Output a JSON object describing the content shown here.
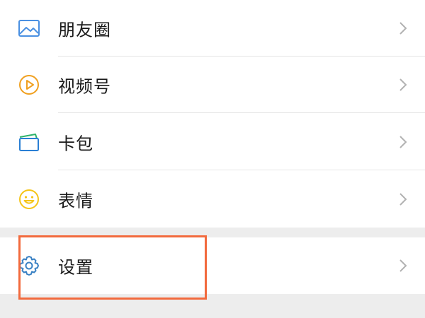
{
  "menu": {
    "items": [
      {
        "label": "朋友圈",
        "icon": "moments-icon"
      },
      {
        "label": "视频号",
        "icon": "channels-icon"
      },
      {
        "label": "卡包",
        "icon": "card-wallet-icon"
      },
      {
        "label": "表情",
        "icon": "sticker-icon"
      }
    ],
    "settings": {
      "label": "设置",
      "icon": "gear-icon"
    }
  },
  "colors": {
    "moments_icon": "#4a90e2",
    "channels_icon": "#f0a020",
    "card_icon": "#2a7fd4",
    "card_accent": "#2fb36b",
    "sticker_icon": "#f5c518",
    "settings_icon": "#3b82c4",
    "highlight": "#f26a3d"
  }
}
